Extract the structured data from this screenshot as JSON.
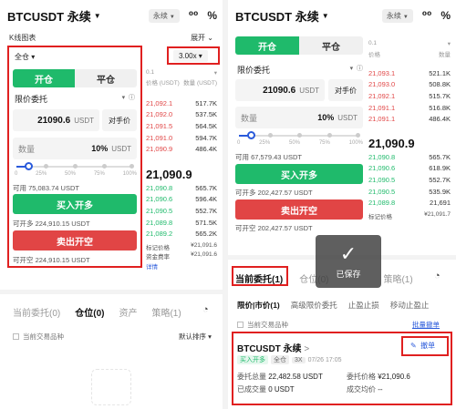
{
  "colors": {
    "buy": "#1fba6b",
    "sell": "#e14545",
    "accent": "#2a5adb",
    "highlight": "#e02020"
  },
  "left": {
    "title": "BTCUSDT 永续",
    "mode_pill": "永续",
    "chart_label": "K线图表",
    "expand_label": "展开",
    "margin_mode": "全仓",
    "leverage": "3.00x",
    "tab_open": "开仓",
    "tab_close": "平仓",
    "order_type": "限价委托",
    "price_value": "21090.6",
    "price_unit": "USDT",
    "opponent_price": "对手价",
    "qty_label": "数量",
    "qty_percent": "10%",
    "qty_unit": "USDT",
    "slider_ticks": [
      "0",
      "25%",
      "50%",
      "75%",
      "100%"
    ],
    "slider_fraction": 0.1,
    "available": "可用 75,083.74 USDT",
    "buy_button": "买入开多",
    "can_open_long": "可开多 224,910.15 USDT",
    "sell_button": "卖出开空",
    "can_open_short": "可开空 224,910.15 USDT",
    "book_header_price": "价格 (USDT)",
    "book_header_qty": "数量 (USDT)",
    "book_depth": "0.1",
    "asks": [
      {
        "price": "21,092.1",
        "qty": "517.7K"
      },
      {
        "price": "21,092.0",
        "qty": "537.5K"
      },
      {
        "price": "21,091.5",
        "qty": "564.5K"
      },
      {
        "price": "21,091.0",
        "qty": "594.7K"
      },
      {
        "price": "21,090.9",
        "qty": "486.4K"
      }
    ],
    "mid_price": "21,090.9",
    "bids": [
      {
        "price": "21,090.8",
        "qty": "565.7K"
      },
      {
        "price": "21,090.6",
        "qty": "596.4K"
      },
      {
        "price": "21,090.5",
        "qty": "552.7K"
      },
      {
        "price": "21,089.8",
        "qty": "571.5K"
      },
      {
        "price": "21,089.2",
        "qty": "565.2K"
      }
    ],
    "mark_label": "标记价格",
    "mark_value": "¥21,091.6",
    "funding_label": "资金费率",
    "funding_value": "¥21,091.6",
    "detail_label": "详情",
    "bottom_tabs": [
      "当前委托(0)",
      "仓位(0)",
      "资产",
      "策略(1)"
    ],
    "bottom_active": 1,
    "current_only": "当前交易品种",
    "sort_label": "默认排序"
  },
  "right": {
    "title": "BTCUSDT 永续",
    "mode_pill": "永续",
    "tab_open": "开仓",
    "tab_close": "平仓",
    "book_depth": "0.1",
    "book_header_price": "价格",
    "book_header_qty": "数量",
    "order_type": "限价委托",
    "price_value": "21090.6",
    "price_unit": "USDT",
    "opponent_price": "对手价",
    "qty_label": "数量",
    "qty_percent": "10%",
    "qty_unit": "USDT",
    "slider_ticks": [
      "0",
      "25%",
      "50%",
      "75%",
      "100%"
    ],
    "slider_fraction": 0.1,
    "available": "可用 67,579.43 USDT",
    "buy_button": "买入开多",
    "can_open_long": "可开多 202,427.57 USDT",
    "sell_button": "卖出开空",
    "can_open_short": "可开空 202,427.57 USDT",
    "asks": [
      {
        "price": "21,093.1",
        "qty": "521.1K"
      },
      {
        "price": "21,093.0",
        "qty": "508.8K"
      },
      {
        "price": "21,092.1",
        "qty": "515.7K"
      },
      {
        "price": "21,091.1",
        "qty": "516.8K"
      },
      {
        "price": "21,091.1",
        "qty": "486.4K"
      }
    ],
    "mid_price": "21,090.9",
    "bids": [
      {
        "price": "21,090.8",
        "qty": "565.7K"
      },
      {
        "price": "21,090.6",
        "qty": "618.9K"
      },
      {
        "price": "21,090.5",
        "qty": "552.7K"
      },
      {
        "price": "21,090.5",
        "qty": "535.9K"
      },
      {
        "price": "21,089.8",
        "qty": "21,691"
      }
    ],
    "mark_label": "标记价格",
    "mark_value": "¥21,091.7",
    "toast_text": "已保存",
    "bottom_tabs": [
      "当前委托(1)",
      "仓位(0)",
      "策略(1)"
    ],
    "sub_tabs": [
      "限价|市价(1)",
      "高级限价委托",
      "止盈止损",
      "移动止盈止"
    ],
    "current_only": "当前交易品种",
    "batch_cancel": "批量撤单",
    "order_title": "BTCUSDT 永续",
    "order_chevron": ">",
    "order_side": "买入开多",
    "order_margin": "全仓",
    "order_lev": "3X",
    "order_time": "07/26 17:05",
    "cancel_label": "撤单",
    "entrust_total_label": "委托总量",
    "entrust_total_value": "22,482.58 USDT",
    "entrust_price_label": "委托价格",
    "entrust_price_value": "¥21,090.6",
    "filled_label": "已成交量",
    "filled_value": "0 USDT",
    "avg_label": "成交均价",
    "avg_value": "--"
  }
}
